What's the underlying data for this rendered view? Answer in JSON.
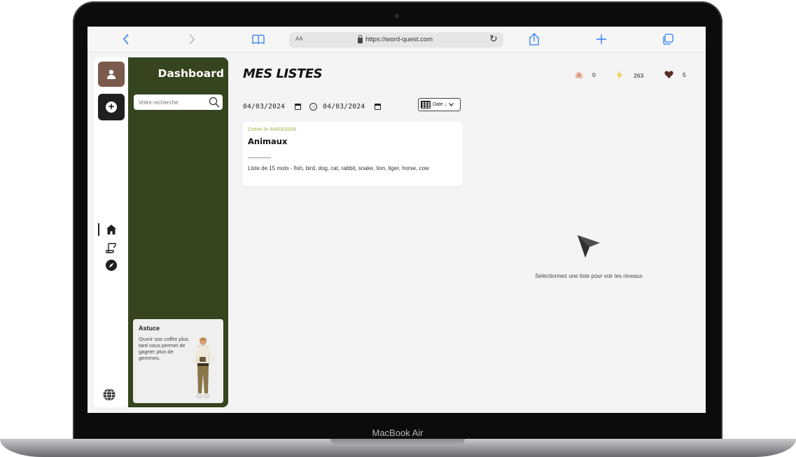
{
  "device": {
    "label": "MacBook Air"
  },
  "browser": {
    "text_size_label": "AA",
    "url": "https://word-quest.com"
  },
  "sidebar": {
    "title": "Dashboard",
    "search_placeholder": "Votre recherche",
    "tip": {
      "title": "Astuce",
      "text": "Ouvrir son coffre plus tard vous permet de gagner plus de gemmes."
    }
  },
  "main": {
    "title": "MES LISTES",
    "stats": [
      {
        "icon": "chest-icon",
        "value": "0"
      },
      {
        "icon": "lightning-icon",
        "value": "263"
      },
      {
        "icon": "heart-icon",
        "value": "5"
      }
    ],
    "date_from": "04/03/2024",
    "date_to": "04/03/2024",
    "sort_label": "Date ↓",
    "lists": [
      {
        "created": "Créée le 04/03/2024",
        "title": "Animaux",
        "description": "Liste de 15 mots - fish, bird, dog, cat, rabbit, snake, lion, tiger, horse, cow"
      }
    ],
    "empty_state": "Selectionnez une liste pour voir les niveaux"
  },
  "colors": {
    "sidebar_bg": "#36441f",
    "avatar_bg": "#7a5a4a",
    "accent_date": "#b9c77a",
    "browser_blue": "#2f7df6",
    "lightning": "#f2d23c",
    "heart": "#5a2a22"
  }
}
